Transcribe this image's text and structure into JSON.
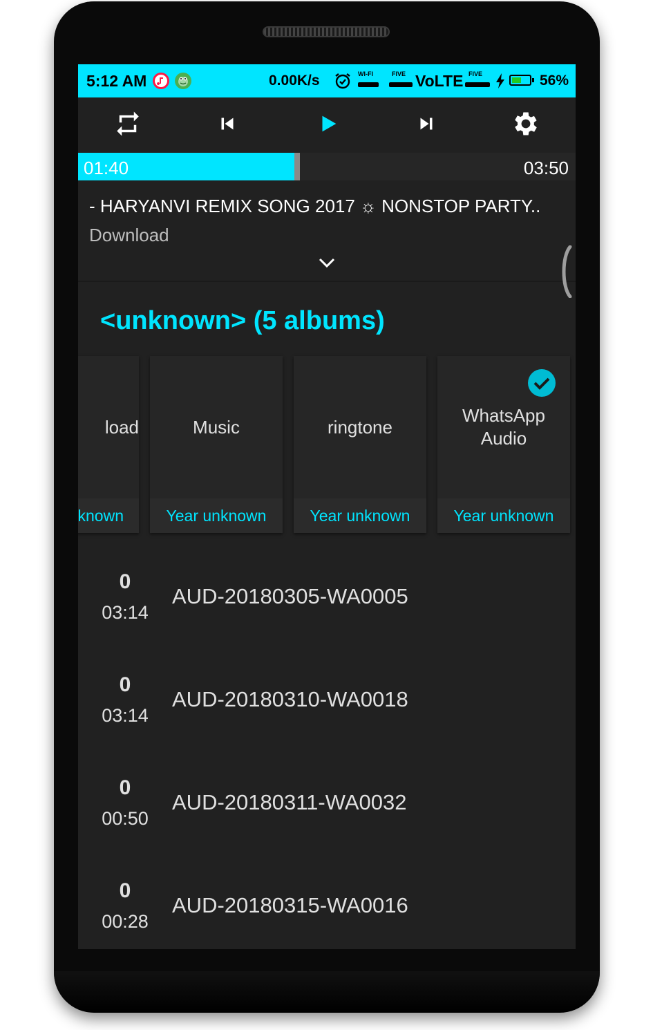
{
  "status_bar": {
    "time": "5:12 AM",
    "net_speed": "0.00K/s",
    "wifi_label": "WI-FI",
    "sim1_label": "FIVE",
    "volte": "VoLTE",
    "sim2_label": "FIVE",
    "battery": "56%",
    "battery_level": 0.56,
    "colors": {
      "bar": "#00e5ff",
      "app_icon_1": "#ff1744",
      "app_icon_2": "#4caf50"
    }
  },
  "player": {
    "controls": [
      "repeat-icon",
      "skip-previous-icon",
      "play-icon",
      "skip-next-icon",
      "settings-icon"
    ],
    "elapsed": "01:40",
    "total": "03:50",
    "progress_fraction": 0.435,
    "track_title": "- HARYANVI REMIX SONG 2017 ☼ NONSTOP PARTY..",
    "track_subtitle": "Download",
    "accent": "#00e5ff"
  },
  "artist_header": "<unknown> (5 albums)",
  "albums": [
    {
      "name": "load",
      "year": "known",
      "selected": false
    },
    {
      "name": "Music",
      "year": "Year unknown",
      "selected": false
    },
    {
      "name": "ringtone",
      "year": "Year unknown",
      "selected": false
    },
    {
      "name": "WhatsApp\nAudio",
      "year": "Year unknown",
      "selected": true
    }
  ],
  "tracks": [
    {
      "number": "0",
      "duration": "03:14",
      "title": "AUD-20180305-WA0005"
    },
    {
      "number": "0",
      "duration": "03:14",
      "title": "AUD-20180310-WA0018"
    },
    {
      "number": "0",
      "duration": "00:50",
      "title": "AUD-20180311-WA0032"
    },
    {
      "number": "0",
      "duration": "00:28",
      "title": "AUD-20180315-WA0016"
    }
  ]
}
